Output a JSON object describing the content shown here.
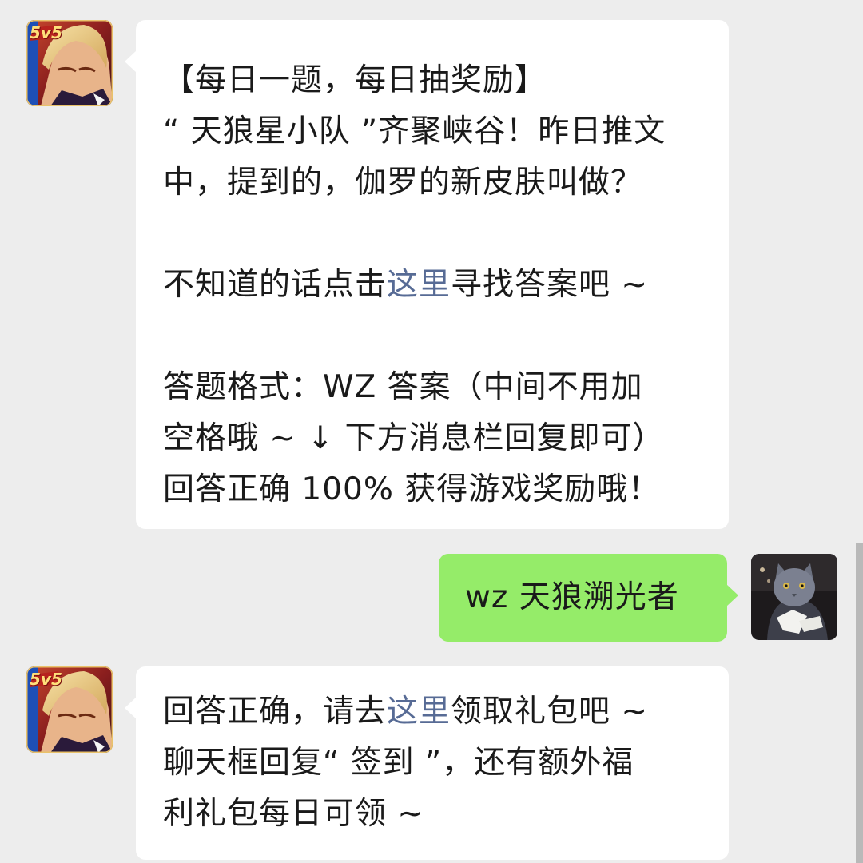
{
  "messages": [
    {
      "sender": "official",
      "avatar_icon": "game-logo-hero-icon",
      "avatar_badge": "5v5",
      "lines": [
        "【每日一题，每日抽奖励】",
        "“ 天狼星小队 ”齐聚峡谷！昨日推文",
        "中，提到的，伽罗的新皮肤叫做？",
        "",
        {
          "before": "不知道的话点击",
          "link": "这里",
          "after": "寻找答案吧 ~"
        },
        "",
        "答题格式：WZ 答案（中间不用加",
        "空格哦 ~ ↓ 下方消息栏回复即可）",
        "回答正确 100% 获得游戏奖励哦！"
      ]
    },
    {
      "sender": "user",
      "avatar_icon": "cat-photo-icon",
      "text": "wz 天狼溯光者"
    },
    {
      "sender": "official",
      "avatar_icon": "game-logo-hero-icon",
      "avatar_badge": "5v5",
      "lines": [
        {
          "before": "回答正确，请去",
          "link": "这里",
          "after": "领取礼包吧 ~"
        },
        "聊天框回复“ 签到 ”，还有额外福",
        "利礼包每日可领 ~"
      ]
    }
  ],
  "colors": {
    "background": "#ededed",
    "incoming_bubble": "#ffffff",
    "outgoing_bubble": "#95ec69",
    "link": "#576b95",
    "text": "#1a1a1a"
  }
}
